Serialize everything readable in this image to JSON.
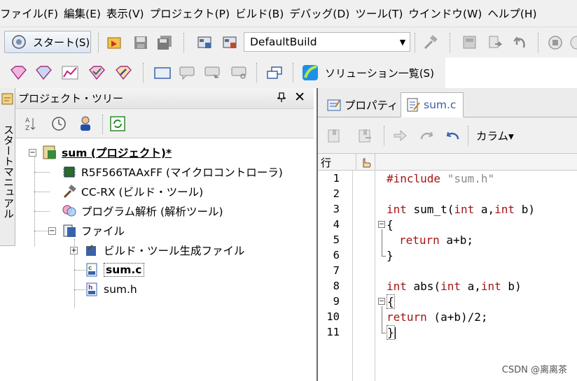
{
  "menubar": {
    "items": [
      "ファイル(F)",
      "編集(E)",
      "表示(V)",
      "プロジェクト(P)",
      "ビルド(B)",
      "デバッグ(D)",
      "ツール(T)",
      "ウインドウ(W)",
      "ヘルプ(H)"
    ]
  },
  "toolbar": {
    "start_label": "スタート(S)",
    "build_config": "DefaultBuild",
    "solution_label": "ソリューション一覧(S)"
  },
  "sidetab": {
    "label": "スタートマニュアル"
  },
  "project_tree": {
    "title": "プロジェクト・ツリー",
    "pin": "ᵖ",
    "close": "✕",
    "nodes": {
      "project": "sum (プロジェクト)*",
      "mcu": "R5F566TAAxFF (マイクロコントローラ)",
      "build_tool": "CC-RX (ビルド・ツール)",
      "analysis": "プログラム解析 (解析ツール)",
      "files": "ファイル",
      "generated": "ビルド・ツール生成ファイル",
      "sum_c": "sum.c",
      "sum_h": "sum.h"
    }
  },
  "editor": {
    "tabs": {
      "properties": "プロパティ",
      "sum_c": "sum.c"
    },
    "columns_label": "カラム▾",
    "line_header": "行",
    "line_numbers": [
      "1",
      "2",
      "3",
      "4",
      "5",
      "6",
      "7",
      "8",
      "9",
      "10",
      "11"
    ],
    "code": {
      "l1_kw": "#include",
      "l1_str": "\"sum.h\"",
      "l3_a": "int",
      "l3_b": " sum_t(",
      "l3_c": "int",
      "l3_d": " a,",
      "l3_e": "int",
      "l3_f": " b)",
      "l4": "{",
      "l5_kw": "return",
      "l5_rest": " a+b;",
      "l6": "}",
      "l8_a": "int",
      "l8_b": " abs(",
      "l8_c": "int",
      "l8_d": " a,",
      "l8_e": "int",
      "l8_f": " b)",
      "l9": "{",
      "l10_kw": "return",
      "l10_rest": " (a+b)/2;",
      "l11": "}"
    }
  },
  "watermark": "CSDN @离离茶",
  "colors": {
    "keyword": "#a31515",
    "string": "#8a8a8a",
    "panel": "#f0f0f0"
  }
}
